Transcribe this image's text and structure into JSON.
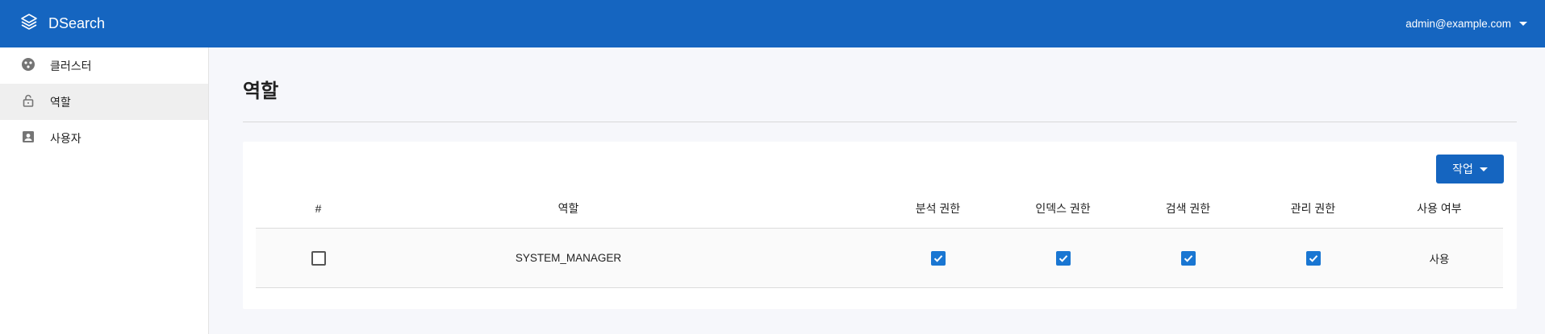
{
  "header": {
    "brand": "DSearch",
    "brand_icon": "layers-icon",
    "user": "admin@example.com",
    "color": "#1565c0"
  },
  "sidebar": {
    "items": [
      {
        "label": "클러스터",
        "icon": "cluster-icon",
        "active": false
      },
      {
        "label": "역할",
        "icon": "lock-icon",
        "active": true
      },
      {
        "label": "사용자",
        "icon": "user-icon",
        "active": false
      }
    ]
  },
  "main": {
    "title": "역할",
    "action_label": "작업",
    "table": {
      "columns": [
        "#",
        "역할",
        "분석 권한",
        "인덱스 권한",
        "검색 권한",
        "관리 권한",
        "사용 여부"
      ],
      "rows": [
        {
          "selected": false,
          "role": "SYSTEM_MANAGER",
          "analysis": true,
          "index": true,
          "search": true,
          "manage": true,
          "usage": "사용"
        }
      ]
    }
  }
}
